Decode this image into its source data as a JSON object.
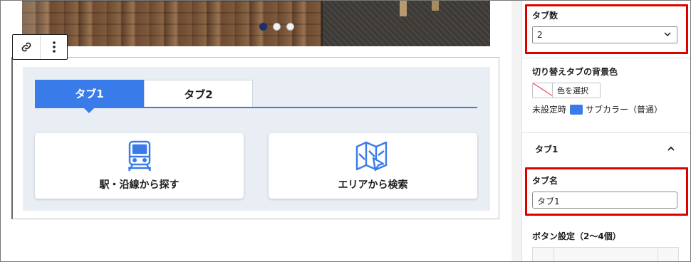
{
  "canvas": {
    "slider_dots": [
      {
        "active": true
      },
      {
        "active": false
      },
      {
        "active": false
      }
    ],
    "toolbar": {
      "link_icon": "link-icon",
      "more_icon": "more-vertical-icon"
    },
    "tabs": [
      {
        "label": "タブ1",
        "active": true
      },
      {
        "label": "タブ2",
        "active": false
      }
    ],
    "cards": [
      {
        "label": "駅・沿線から探す",
        "icon": "train-icon"
      },
      {
        "label": "エリアから検索",
        "icon": "map-cursor-icon"
      }
    ],
    "colors": {
      "accent": "#3a7bea",
      "tab_area_bg": "#e9edf4",
      "highlight": "#e00000"
    }
  },
  "sidebar": {
    "tab_count_label": "タブ数",
    "tab_count_value": "2",
    "bg_color_label": "切り替えタブの背景色",
    "color_select_label": "色を選択",
    "default_label": "未設定時",
    "default_value": "サブカラー（普通）",
    "tab1_section_title": "タブ1",
    "tab_name_label": "タブ名",
    "tab_name_value": "タブ1",
    "button_settings_label": "ボタン設定（2〜4個）"
  }
}
